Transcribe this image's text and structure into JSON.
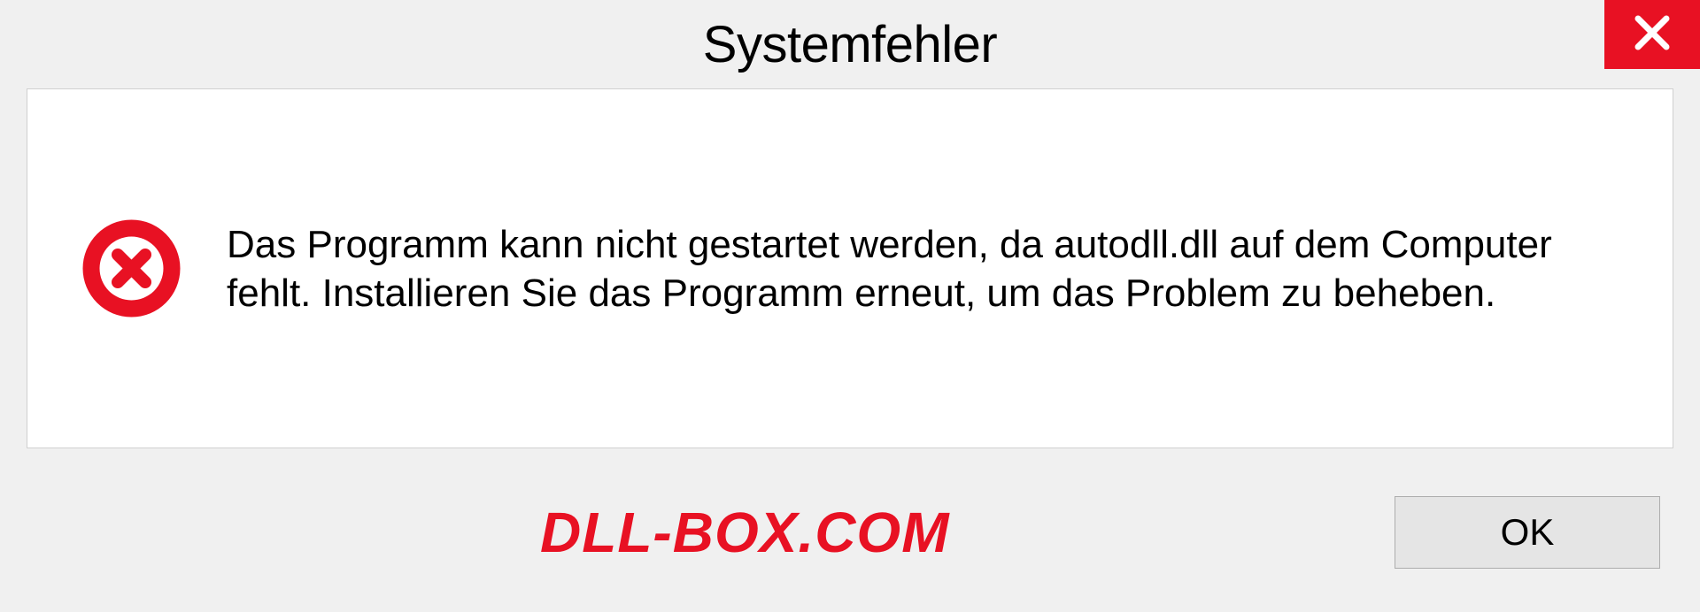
{
  "dialog": {
    "title": "Systemfehler",
    "message": "Das Programm kann nicht gestartet werden, da autodll.dll auf dem Computer fehlt. Installieren Sie das Programm erneut, um das Problem zu beheben.",
    "ok_label": "OK",
    "watermark": "DLL-BOX.COM"
  }
}
